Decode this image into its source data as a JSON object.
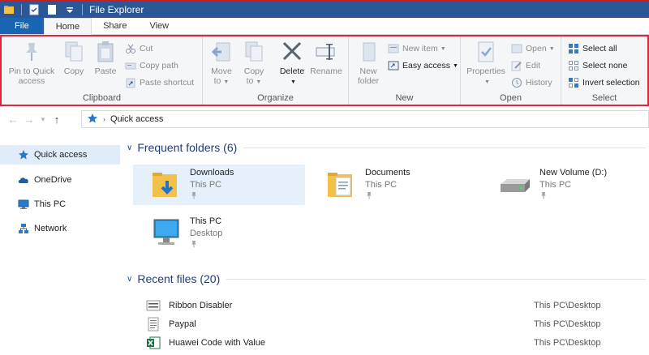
{
  "window": {
    "title": "File Explorer"
  },
  "tabs": [
    {
      "label": "File"
    },
    {
      "label": "Home"
    },
    {
      "label": "Share"
    },
    {
      "label": "View"
    }
  ],
  "ribbon": {
    "clipboard": {
      "label": "Clipboard",
      "pin_label": "Pin to Quick access",
      "copy_label": "Copy",
      "paste_label": "Paste",
      "cut_label": "Cut",
      "copy_path_label": "Copy path",
      "paste_shortcut_label": "Paste shortcut"
    },
    "organize": {
      "label": "Organize",
      "move_to_label": "Move to",
      "copy_to_label": "Copy to",
      "delete_label": "Delete",
      "rename_label": "Rename"
    },
    "new": {
      "label": "New",
      "new_folder_label": "New folder",
      "new_item_label": "New item",
      "easy_access_label": "Easy access"
    },
    "open": {
      "label": "Open",
      "properties_label": "Properties",
      "open_label": "Open",
      "edit_label": "Edit",
      "history_label": "History"
    },
    "select": {
      "label": "Select",
      "select_all_label": "Select all",
      "select_none_label": "Select none",
      "invert_label": "Invert selection"
    }
  },
  "address": {
    "path": "Quick access"
  },
  "nav": [
    {
      "label": "Quick access",
      "icon": "star-pin-icon"
    },
    {
      "label": "OneDrive",
      "icon": "cloud-icon"
    },
    {
      "label": "This PC",
      "icon": "monitor-icon"
    },
    {
      "label": "Network",
      "icon": "network-icon"
    }
  ],
  "frequent": {
    "title": "Frequent folders (6)",
    "items": [
      {
        "name": "Downloads",
        "location": "This PC"
      },
      {
        "name": "Documents",
        "location": "This PC"
      },
      {
        "name": "New Volume (D:)",
        "location": "This PC"
      },
      {
        "name": "This PC",
        "location": "Desktop"
      }
    ]
  },
  "recent": {
    "title": "Recent files (20)",
    "items": [
      {
        "name": "Ribbon Disabler",
        "path": "This PC\\Desktop"
      },
      {
        "name": "Paypal",
        "path": "This PC\\Desktop"
      },
      {
        "name": "Huawei Code with Value",
        "path": "This PC\\Desktop"
      }
    ]
  },
  "colors": {
    "titlebar": "#2b5797",
    "file_tab": "#1a64b4",
    "highlight_border": "#e3243b",
    "selection": "#e5f0fb"
  }
}
